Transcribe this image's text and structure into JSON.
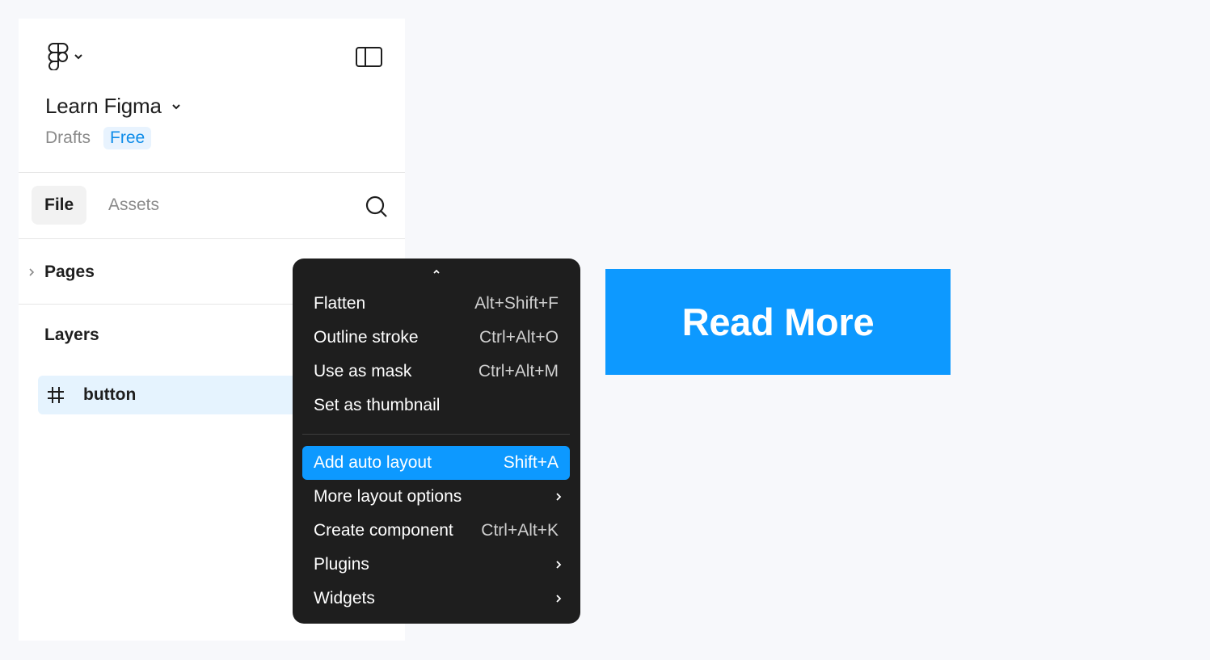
{
  "header": {
    "file_title": "Learn Figma",
    "breadcrumb_drafts": "Drafts",
    "plan_badge": "Free"
  },
  "tabs": [
    {
      "label": "File",
      "active": true
    },
    {
      "label": "Assets",
      "active": false
    }
  ],
  "sections": {
    "pages_label": "Pages",
    "layers_label": "Layers"
  },
  "layers": [
    {
      "name": "button",
      "icon": "frame-icon",
      "selected": true
    }
  ],
  "context_menu": {
    "items": [
      {
        "label": "Flatten",
        "shortcut": "Alt+Shift+F"
      },
      {
        "label": "Outline stroke",
        "shortcut": "Ctrl+Alt+O"
      },
      {
        "label": "Use as mask",
        "shortcut": "Ctrl+Alt+M"
      },
      {
        "label": "Set as thumbnail",
        "shortcut": ""
      },
      {
        "label": "Add auto layout",
        "shortcut": "Shift+A",
        "highlighted": true
      },
      {
        "label": "More layout options",
        "shortcut": "",
        "submenu": true
      },
      {
        "label": "Create component",
        "shortcut": "Ctrl+Alt+K"
      },
      {
        "label": "Plugins",
        "shortcut": "",
        "submenu": true
      },
      {
        "label": "Widgets",
        "shortcut": "",
        "submenu": true
      }
    ]
  },
  "canvas": {
    "button_label": "Read More"
  },
  "icons": {
    "logo": "figma-logo-icon",
    "sidebar_toggle": "sidebar-toggle-icon",
    "search": "search-icon",
    "frame": "frame-icon"
  },
  "colors": {
    "accent": "#0d99ff",
    "badge_text": "#0d8ce9",
    "badge_bg": "#e8f3fe",
    "selection_bg": "#e5f3fe",
    "menu_bg": "#1e1e1e",
    "canvas_bg": "#f7f8fb"
  }
}
